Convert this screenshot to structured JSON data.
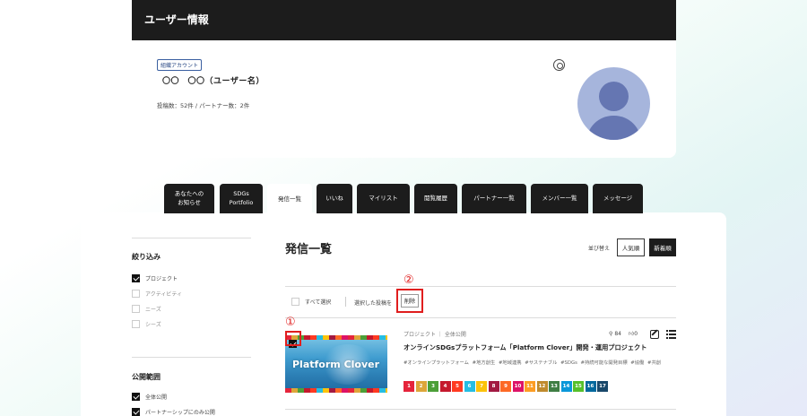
{
  "header": {
    "title": "ユーザー情報",
    "badge": "組織アカウント",
    "username": "〇〇　〇〇（ユーザー名）",
    "stats": "投稿数：52件 / パートナー数：2件"
  },
  "tabs": [
    {
      "label": "あなたへの\nお知らせ"
    },
    {
      "label": "SDGs\nPortfolio"
    },
    {
      "label": "発信一覧"
    },
    {
      "label": "いいね"
    },
    {
      "label": "マイリスト"
    },
    {
      "label": "閲覧履歴"
    },
    {
      "label": "パートナー一覧"
    },
    {
      "label": "メンバー一覧"
    },
    {
      "label": "メッセージ"
    }
  ],
  "active_tab": "発信一覧",
  "filter": {
    "title": "絞り込み",
    "items": [
      {
        "label": "プロジェクト",
        "checked": true
      },
      {
        "label": "アクティビティ",
        "checked": false
      },
      {
        "label": "ニーズ",
        "checked": false
      },
      {
        "label": "シーズ",
        "checked": false
      }
    ]
  },
  "scope": {
    "title": "公開範囲",
    "items": [
      {
        "label": "全体公開",
        "checked": true
      },
      {
        "label": "パートナーシップにのみ公開",
        "checked": true
      }
    ]
  },
  "main": {
    "title": "発信一覧",
    "sort_label": "並び替え",
    "sort_popular": "人気順",
    "sort_newest": "新着順",
    "select_all": "すべて選択",
    "selected_posts": "選択した投稿を",
    "delete": "削除"
  },
  "annotations": {
    "one": "①",
    "two": "②"
  },
  "post": {
    "checked": true,
    "meta": "プロジェクト ｜ 全体公開",
    "title": "オンラインSDGsプラットフォーム「Platform Clover」開発・運用プロジェクト",
    "tags": "#オンラインプラットフォーム #地方創生 #地域連携 #サステナブル #SDGs #持続可能な開発目標 #協働 #共創",
    "thumbnail_text": "Platform Clover",
    "views": "84",
    "likes": "0",
    "sdgs": [
      {
        "n": "1",
        "color": "#e5243b"
      },
      {
        "n": "2",
        "color": "#dda63a"
      },
      {
        "n": "3",
        "color": "#4c9f38"
      },
      {
        "n": "4",
        "color": "#c5192d"
      },
      {
        "n": "5",
        "color": "#ff3a21"
      },
      {
        "n": "6",
        "color": "#26bde2"
      },
      {
        "n": "7",
        "color": "#fcc30b"
      },
      {
        "n": "8",
        "color": "#a21942"
      },
      {
        "n": "9",
        "color": "#fd6925"
      },
      {
        "n": "10",
        "color": "#dd1367"
      },
      {
        "n": "11",
        "color": "#fd9d24"
      },
      {
        "n": "12",
        "color": "#bf8b2e"
      },
      {
        "n": "13",
        "color": "#3f7e44"
      },
      {
        "n": "14",
        "color": "#0a97d9"
      },
      {
        "n": "15",
        "color": "#56c02b"
      },
      {
        "n": "16",
        "color": "#00689d"
      },
      {
        "n": "17",
        "color": "#19486a"
      }
    ]
  }
}
